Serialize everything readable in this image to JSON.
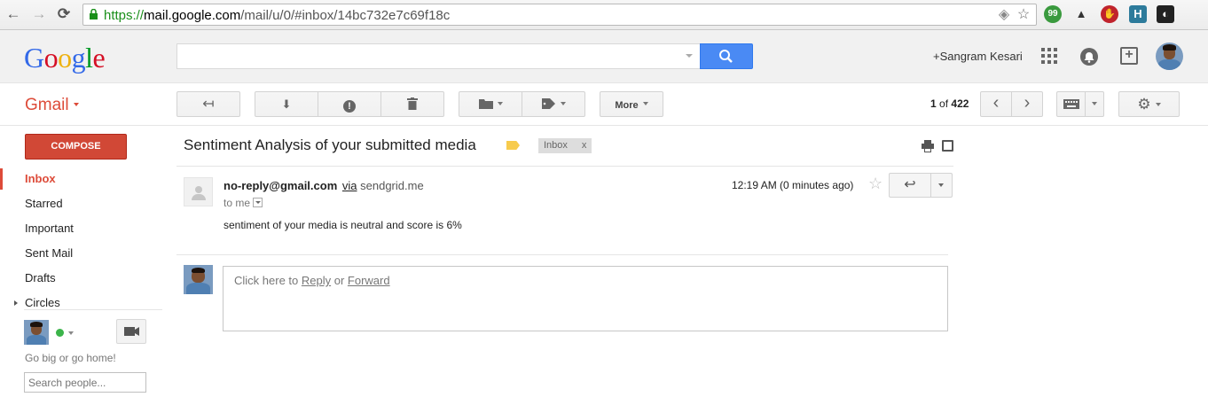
{
  "browser": {
    "url_scheme": "https://",
    "url_host": "mail.google.com",
    "url_path": "/mail/u/0/#inbox/14bc732e7c69f18c",
    "back_glyph": "←",
    "forward_glyph": "→",
    "reload_glyph": "⟳",
    "star_glyph": "☆",
    "extensions": [
      {
        "name": "hangouts",
        "glyph": "99",
        "color": "#3a9a3e"
      },
      {
        "name": "camera",
        "glyph": "▲",
        "color": "#333333"
      },
      {
        "name": "adblock",
        "glyph": "✋",
        "color": "#c0232c"
      },
      {
        "name": "h-extension",
        "glyph": "H",
        "color": "#2d7b9b"
      },
      {
        "name": "incognito",
        "glyph": "◐",
        "color": "#222222"
      }
    ]
  },
  "header": {
    "logo_letters": [
      "G",
      "o",
      "o",
      "g",
      "l",
      "e"
    ],
    "logo_colors": [
      "#3369e8",
      "#d50f25",
      "#eeb211",
      "#3369e8",
      "#009925",
      "#d50f25"
    ],
    "search_placeholder": "",
    "username": "+Sangram Kesari",
    "share_glyph": "+"
  },
  "toolbar": {
    "gmail_label": "Gmail",
    "back_glyph": "↤",
    "archive_glyph": "⬇",
    "spam_glyph": "!",
    "delete_glyph": "🗑",
    "move_glyph": "▬",
    "labels_glyph": "◆",
    "more_label": "More",
    "page_current": "1",
    "page_of": "of",
    "page_total": "422",
    "prev_glyph": "‹",
    "next_glyph": "›",
    "keyboard_glyph": "⌨",
    "settings_glyph": "⚙"
  },
  "sidebar": {
    "compose_label": "COMPOSE",
    "items": [
      {
        "label": "Inbox",
        "active": true
      },
      {
        "label": "Starred",
        "active": false
      },
      {
        "label": "Important",
        "active": false
      },
      {
        "label": "Sent Mail",
        "active": false
      },
      {
        "label": "Drafts",
        "active": false
      },
      {
        "label": "Circles",
        "active": false
      }
    ],
    "motto": "Go big or go home!",
    "search_people_placeholder": "Search people..."
  },
  "message": {
    "subject": "Sentiment Analysis of your submitted media",
    "label_chip": "Inbox",
    "label_chip_close": "x",
    "sender_email": "no-reply@gmail.com",
    "via_text": "via",
    "via_domain": "sendgrid.me",
    "to_text": "to me",
    "timestamp": "12:19 AM (0 minutes ago)",
    "reply_glyph": "↩",
    "body": "sentiment of your media is neutral and score is 6%",
    "reply_prompt_prefix": "Click here to ",
    "reply_link": "Reply",
    "reply_or": " or ",
    "forward_link": "Forward"
  }
}
